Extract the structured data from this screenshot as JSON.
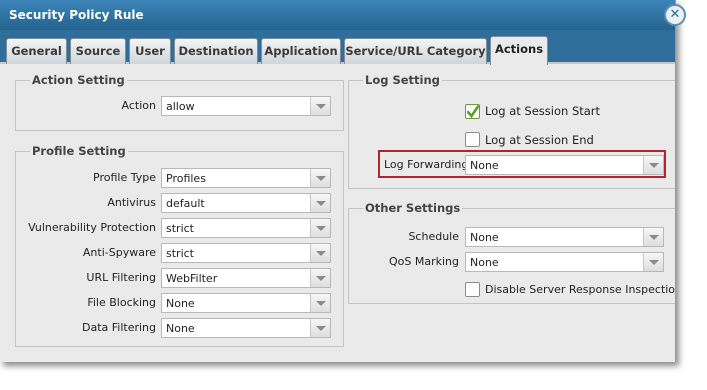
{
  "window": {
    "title": "Security Policy Rule",
    "close_glyph": "✕"
  },
  "tabs": [
    {
      "label": "General"
    },
    {
      "label": "Source"
    },
    {
      "label": "User"
    },
    {
      "label": "Destination"
    },
    {
      "label": "Application"
    },
    {
      "label": "Service/URL Category"
    },
    {
      "label": "Actions",
      "active": true
    }
  ],
  "action_setting": {
    "title": "Action Setting",
    "action": {
      "label": "Action",
      "value": "allow"
    }
  },
  "profile_setting": {
    "title": "Profile Setting",
    "fields": [
      {
        "label": "Profile Type",
        "value": "Profiles"
      },
      {
        "label": "Antivirus",
        "value": "default"
      },
      {
        "label": "Vulnerability Protection",
        "value": "strict"
      },
      {
        "label": "Anti-Spyware",
        "value": "strict"
      },
      {
        "label": "URL Filtering",
        "value": "WebFilter"
      },
      {
        "label": "File Blocking",
        "value": "None"
      },
      {
        "label": "Data Filtering",
        "value": "None"
      }
    ]
  },
  "log_setting": {
    "title": "Log Setting",
    "log_start": {
      "label": "Log at Session Start",
      "checked": true
    },
    "log_end": {
      "label": "Log at Session End",
      "checked": false
    },
    "log_forwarding": {
      "label": "Log Forwarding",
      "value": "None"
    }
  },
  "other_settings": {
    "title": "Other Settings",
    "schedule": {
      "label": "Schedule",
      "value": "None"
    },
    "qos": {
      "label": "QoS Marking",
      "value": "None"
    },
    "disable_sri": {
      "label": "Disable Server Response Inspection",
      "checked": false
    }
  },
  "colors": {
    "title_bar": "#2f6e9b",
    "highlight": "#b0252c",
    "check_green": "#5aa02c"
  }
}
